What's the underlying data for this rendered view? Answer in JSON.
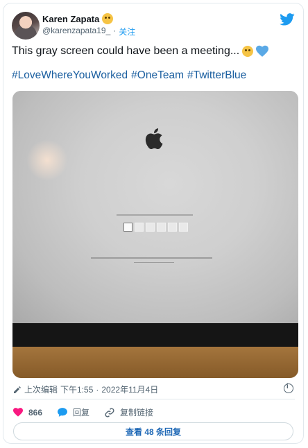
{
  "user": {
    "name": "Karen Zapata",
    "handle": "@karenzapata19_",
    "separator": "·",
    "follow_label": "关注"
  },
  "tweet": {
    "text": "This gray screen could have been a meeting...",
    "hashtags": [
      "#LoveWhereYouWorked",
      "#OneTeam",
      "#TwitterBlue"
    ]
  },
  "meta": {
    "edited_label": "上次编辑",
    "time": "下午1:55",
    "separator": "·",
    "date": "2022年11月4日"
  },
  "actions": {
    "likes_count": "866",
    "reply_label": "回复",
    "copy_link_label": "复制链接"
  },
  "replies_button_label": "查看 48 条回复",
  "colors": {
    "link_blue": "#1d9bf0",
    "hashtag_blue": "#1b5fa0",
    "like_red": "#f91880"
  }
}
